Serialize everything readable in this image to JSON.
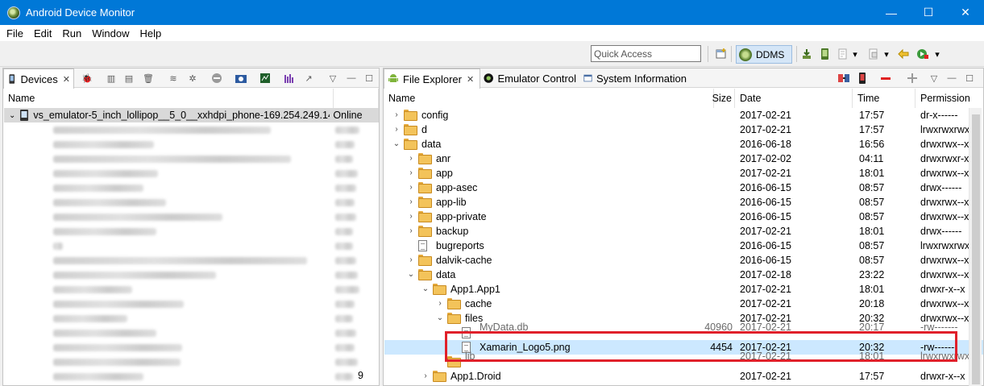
{
  "window": {
    "title": "Android Device Monitor",
    "controls": {
      "minimize": "—",
      "maximize": "☐",
      "close": "✕"
    }
  },
  "menu": [
    "File",
    "Edit",
    "Run",
    "Window",
    "Help"
  ],
  "toolbar": {
    "quick_access_placeholder": "Quick Access",
    "perspective_label": "DDMS"
  },
  "devices_panel": {
    "tab_label": "Devices",
    "column_name": "Name",
    "device_name": "vs_emulator-5_inch_lollipop__5_0__xxhdpi_phone-169.254.249.14",
    "device_status": "Online",
    "trailing_value": "9"
  },
  "file_explorer": {
    "tabs": [
      "File Explorer",
      "Emulator Control",
      "System Information"
    ],
    "columns": {
      "name": "Name",
      "size": "Size",
      "date": "Date",
      "time": "Time",
      "permissions": "Permission"
    },
    "rows": [
      {
        "name": "config",
        "size": "",
        "date": "2017-02-21",
        "time": "17:57",
        "perm": "dr-x------",
        "depth": 0,
        "type": "folder",
        "state": "collapsed"
      },
      {
        "name": "d",
        "size": "",
        "date": "2017-02-21",
        "time": "17:57",
        "perm": "lrwxrwxrwx",
        "depth": 0,
        "type": "folder",
        "state": "collapsed"
      },
      {
        "name": "data",
        "size": "",
        "date": "2016-06-18",
        "time": "16:56",
        "perm": "drwxrwx--x",
        "depth": 0,
        "type": "folder",
        "state": "expanded"
      },
      {
        "name": "anr",
        "size": "",
        "date": "2017-02-02",
        "time": "04:11",
        "perm": "drwxrwxr-x",
        "depth": 1,
        "type": "folder",
        "state": "collapsed"
      },
      {
        "name": "app",
        "size": "",
        "date": "2017-02-21",
        "time": "18:01",
        "perm": "drwxrwx--x",
        "depth": 1,
        "type": "folder",
        "state": "collapsed"
      },
      {
        "name": "app-asec",
        "size": "",
        "date": "2016-06-15",
        "time": "08:57",
        "perm": "drwx------",
        "depth": 1,
        "type": "folder",
        "state": "collapsed"
      },
      {
        "name": "app-lib",
        "size": "",
        "date": "2016-06-15",
        "time": "08:57",
        "perm": "drwxrwx--x",
        "depth": 1,
        "type": "folder",
        "state": "collapsed"
      },
      {
        "name": "app-private",
        "size": "",
        "date": "2016-06-15",
        "time": "08:57",
        "perm": "drwxrwx--x",
        "depth": 1,
        "type": "folder",
        "state": "collapsed"
      },
      {
        "name": "backup",
        "size": "",
        "date": "2017-02-21",
        "time": "18:01",
        "perm": "drwx------",
        "depth": 1,
        "type": "folder",
        "state": "collapsed"
      },
      {
        "name": "bugreports",
        "size": "",
        "date": "2016-06-15",
        "time": "08:57",
        "perm": "lrwxrwxrwx",
        "depth": 1,
        "type": "file",
        "state": "none"
      },
      {
        "name": "dalvik-cache",
        "size": "",
        "date": "2016-06-15",
        "time": "08:57",
        "perm": "drwxrwx--x",
        "depth": 1,
        "type": "folder",
        "state": "collapsed"
      },
      {
        "name": "data",
        "size": "",
        "date": "2017-02-18",
        "time": "23:22",
        "perm": "drwxrwx--x",
        "depth": 1,
        "type": "folder",
        "state": "expanded"
      },
      {
        "name": "App1.App1",
        "size": "",
        "date": "2017-02-21",
        "time": "18:01",
        "perm": "drwxr-x--x",
        "depth": 2,
        "type": "folder",
        "state": "expanded"
      },
      {
        "name": "cache",
        "size": "",
        "date": "2017-02-21",
        "time": "20:18",
        "perm": "drwxrwx--x",
        "depth": 3,
        "type": "folder",
        "state": "collapsed"
      },
      {
        "name": "files",
        "size": "",
        "date": "2017-02-21",
        "time": "20:32",
        "perm": "drwxrwx--x",
        "depth": 3,
        "type": "folder",
        "state": "expanded"
      },
      {
        "name": "MyData.db",
        "size": "40960",
        "date": "2017-02-21",
        "time": "20:17",
        "perm": "-rw-------",
        "depth": 4,
        "type": "file",
        "state": "none",
        "obscured": true
      },
      {
        "name": "Xamarin_Logo5.png",
        "size": "4454",
        "date": "2017-02-21",
        "time": "20:32",
        "perm": "-rw-------",
        "depth": 4,
        "type": "file",
        "state": "none",
        "selected": true
      },
      {
        "name": "lib",
        "size": "",
        "date": "2017-02-21",
        "time": "18:01",
        "perm": "lrwxrwxrwx",
        "depth": 3,
        "type": "folder",
        "state": "none",
        "obscured": true
      },
      {
        "name": "App1.Droid",
        "size": "",
        "date": "2017-02-21",
        "time": "17:57",
        "perm": "drwxr-x--x",
        "depth": 2,
        "type": "folder",
        "state": "collapsed"
      }
    ]
  }
}
